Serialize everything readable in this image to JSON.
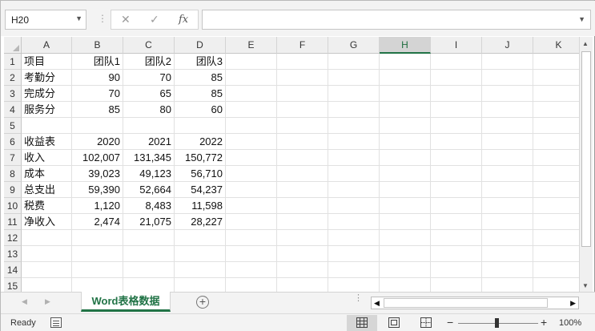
{
  "formula_bar": {
    "name_box": "H20",
    "name_box_arrow": "▼",
    "separator": "⋮",
    "cancel_icon": "✕",
    "enter_icon": "✓",
    "fx_label": "fx",
    "formula_value": "",
    "formula_arrow": "▼"
  },
  "grid": {
    "columns": [
      "A",
      "B",
      "C",
      "D",
      "E",
      "F",
      "G",
      "H",
      "I",
      "J",
      "K"
    ],
    "active_column": "H",
    "rows": [
      "1",
      "2",
      "3",
      "4",
      "5",
      "6",
      "7",
      "8",
      "9",
      "10",
      "11",
      "12",
      "13",
      "14",
      "15"
    ],
    "cells": {
      "A1": "项目",
      "B1": "团队1",
      "C1": "团队2",
      "D1": "团队3",
      "A2": "考勤分",
      "B2": "90",
      "C2": "70",
      "D2": "85",
      "A3": "完成分",
      "B3": "70",
      "C3": "65",
      "D3": "85",
      "A4": "服务分",
      "B4": "85",
      "C4": "80",
      "D4": "60",
      "A6": "收益表",
      "B6": "2020",
      "C6": "2021",
      "D6": "2022",
      "A7": "收入",
      "B7": "102,007",
      "C7": "131,345",
      "D7": "150,772",
      "A8": "成本",
      "B8": "39,023",
      "C8": "49,123",
      "D8": "56,710",
      "A9": "总支出",
      "B9": "59,390",
      "C9": "52,664",
      "D9": "54,237",
      "A10": "税费",
      "B10": "1,120",
      "C10": "8,483",
      "D10": "11,598",
      "A11": "净收入",
      "B11": "2,474",
      "C11": "21,075",
      "D11": "28,227"
    }
  },
  "sheet_tabs": {
    "prev_icon": "◀",
    "next_icon": "▶",
    "tabs": [
      {
        "label": "Word表格数据",
        "active": true
      }
    ],
    "add_icon": "+",
    "dots_icon": "⋮"
  },
  "status_bar": {
    "status_text": "Ready",
    "zoom_minus": "−",
    "zoom_plus": "+",
    "zoom_percent": 100,
    "zoom_level": "100%"
  },
  "colors": {
    "accent": "#217346",
    "header_bg": "#efefef",
    "gridline": "#e1e1e1"
  },
  "icons": {
    "namebox_dropdown": "chevron-down-icon",
    "cancel": "close-icon",
    "enter": "check-icon",
    "function": "fx-icon",
    "add_sheet": "plus-circle-icon",
    "macro": "record-macro-icon",
    "view_normal": "grid-view-icon",
    "view_page_layout": "page-layout-icon",
    "view_page_break": "page-break-icon"
  }
}
